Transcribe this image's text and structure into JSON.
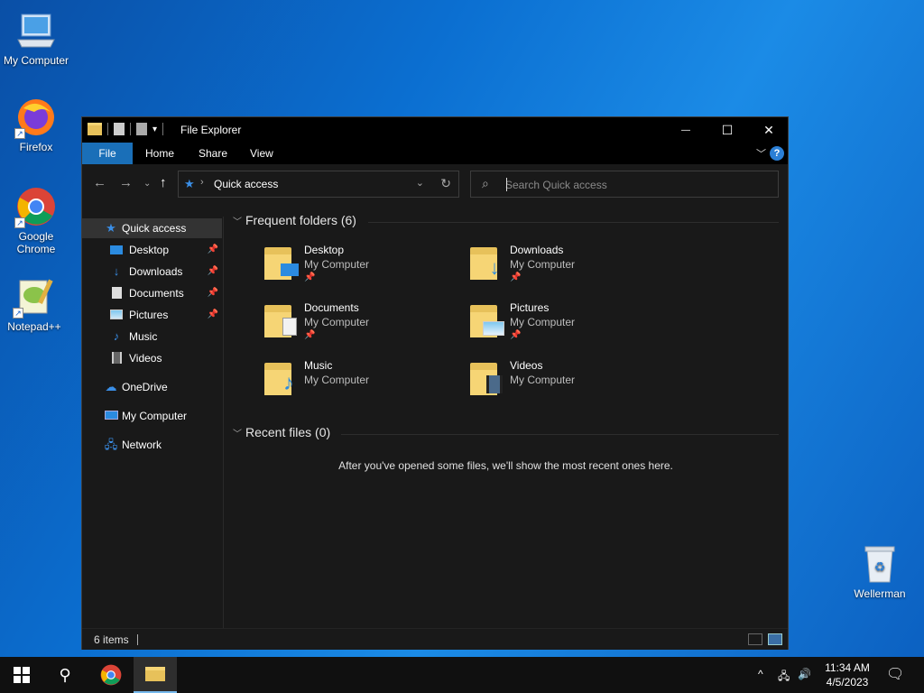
{
  "desktop": {
    "icons": [
      {
        "label": "My Computer"
      },
      {
        "label": "Firefox"
      },
      {
        "label": "Google Chrome"
      },
      {
        "label": "Notepad++"
      },
      {
        "label": "Wellerman"
      }
    ]
  },
  "window": {
    "title": "File Explorer",
    "controls": {
      "minimize": "—",
      "maximize": "☐",
      "close": "✕"
    },
    "ribbon_tabs": [
      "File",
      "Home",
      "Share",
      "View"
    ],
    "help_label": "?",
    "address": {
      "path": "Quick access"
    },
    "search": {
      "placeholder": "Search Quick access",
      "value": ""
    },
    "nav_pane": [
      {
        "label": "Quick access",
        "icon": "star-icon",
        "selected": true
      },
      {
        "label": "Desktop",
        "icon": "desktop-icon",
        "pinned": true
      },
      {
        "label": "Downloads",
        "icon": "download-icon",
        "pinned": true
      },
      {
        "label": "Documents",
        "icon": "document-icon",
        "pinned": true
      },
      {
        "label": "Pictures",
        "icon": "pictures-icon",
        "pinned": true
      },
      {
        "label": "Music",
        "icon": "music-icon"
      },
      {
        "label": "Videos",
        "icon": "video-icon"
      },
      {
        "label": "OneDrive",
        "icon": "cloud-icon"
      },
      {
        "label": "My Computer",
        "icon": "computer-icon"
      },
      {
        "label": "Network",
        "icon": "network-icon"
      }
    ],
    "frequent_folders_header": "Frequent folders (6)",
    "frequent_folders": [
      {
        "name": "Desktop",
        "location": "My Computer",
        "pinned": true
      },
      {
        "name": "Downloads",
        "location": "My Computer",
        "pinned": true
      },
      {
        "name": "Documents",
        "location": "My Computer",
        "pinned": true
      },
      {
        "name": "Pictures",
        "location": "My Computer",
        "pinned": true
      },
      {
        "name": "Music",
        "location": "My Computer",
        "pinned": false
      },
      {
        "name": "Videos",
        "location": "My Computer",
        "pinned": false
      }
    ],
    "recent_files_header": "Recent files (0)",
    "recent_empty_message": "After you've opened some files, we'll show the most recent ones here.",
    "status": {
      "item_count": "6 items"
    }
  },
  "taskbar": {
    "clock_time": "11:34 AM",
    "clock_date": "4/5/2023"
  },
  "colors": {
    "accent": "#1a6fb8",
    "window_bg": "#191919",
    "titlebar_bg": "#000000",
    "folder_yellow": "#f6d575"
  }
}
